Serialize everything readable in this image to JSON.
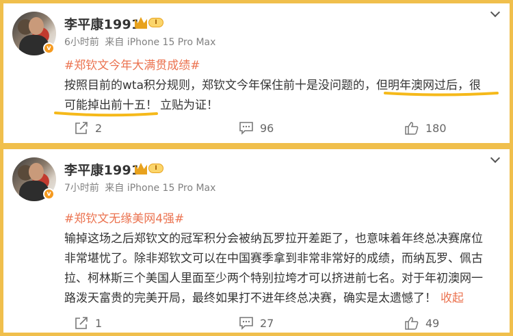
{
  "posts": [
    {
      "username": "李平康1991",
      "level_badge": "I",
      "verified_badge": "v",
      "time": "6小时前",
      "source": "来自 iPhone 15 Pro Max",
      "hashtag": "#郑钦文今年大满贯成绩#",
      "text_part1": "按照目前的wta积分规则，郑钦文今年保住前十是没问题的，",
      "text_part2": "但明年澳网过后，很",
      "text_part3": "可能掉出前十五！",
      "text_part4": "立贴为证！",
      "reposts": "2",
      "comments": "96",
      "likes": "180"
    },
    {
      "username": "李平康1991",
      "level_badge": "I",
      "verified_badge": "v",
      "time": "7小时前",
      "source": "来自 iPhone 15 Pro Max",
      "hashtag": "#郑钦文无缘美网4强#",
      "line1": "输掉这场之后郑钦文的冠军积分会被纳瓦罗拉开差距了，也意味着年终总决赛席位",
      "line2": "非常堪忧了。除非郑钦文可以在中国赛季拿到非常非常好的成绩，而纳瓦罗、佩古",
      "line3": "拉、柯林斯三个美国人里面至少两个特别拉垮才可以挤进前七名。对于年初澳网一",
      "line4": "路泼天富贵的完美开局，最终如果打不进年终总决赛，确实是太遗憾了！",
      "collapse_label": "收起",
      "reposts": "1",
      "comments": "27",
      "likes": "49"
    }
  ],
  "colors": {
    "background": "#f0bf4c",
    "hashtag": "#eb7350",
    "highlight": "#f5b91a"
  }
}
